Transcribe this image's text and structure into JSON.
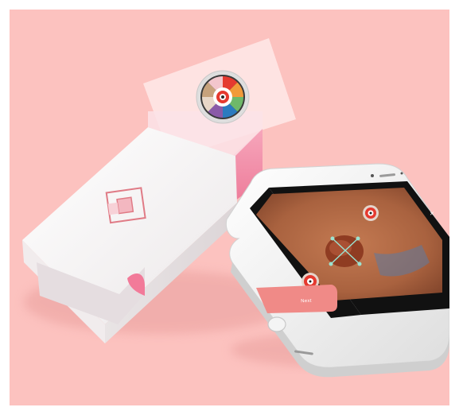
{
  "scene": {
    "background_color": "#fcc2bf",
    "product_box": {
      "box_color": "#f4f1f2",
      "inner_color": "#f38aa6",
      "logo_colors": [
        "#e9737f",
        "#f3b7c0"
      ]
    },
    "color_card": {
      "wheel_colors": [
        "#e5392f",
        "#f19a3a",
        "#6fb86a",
        "#2b7bbf",
        "#8a5aa8",
        "#e8d7c8",
        "#c7a27c",
        "#2b2b2b"
      ]
    },
    "phone": {
      "body_color": "#f2f2f2",
      "screen_photo_color": "#b16a45",
      "button_color": "#f08a87",
      "next_button_label": "Next",
      "close_icon": "close-icon",
      "close_glyph": "✕"
    }
  }
}
